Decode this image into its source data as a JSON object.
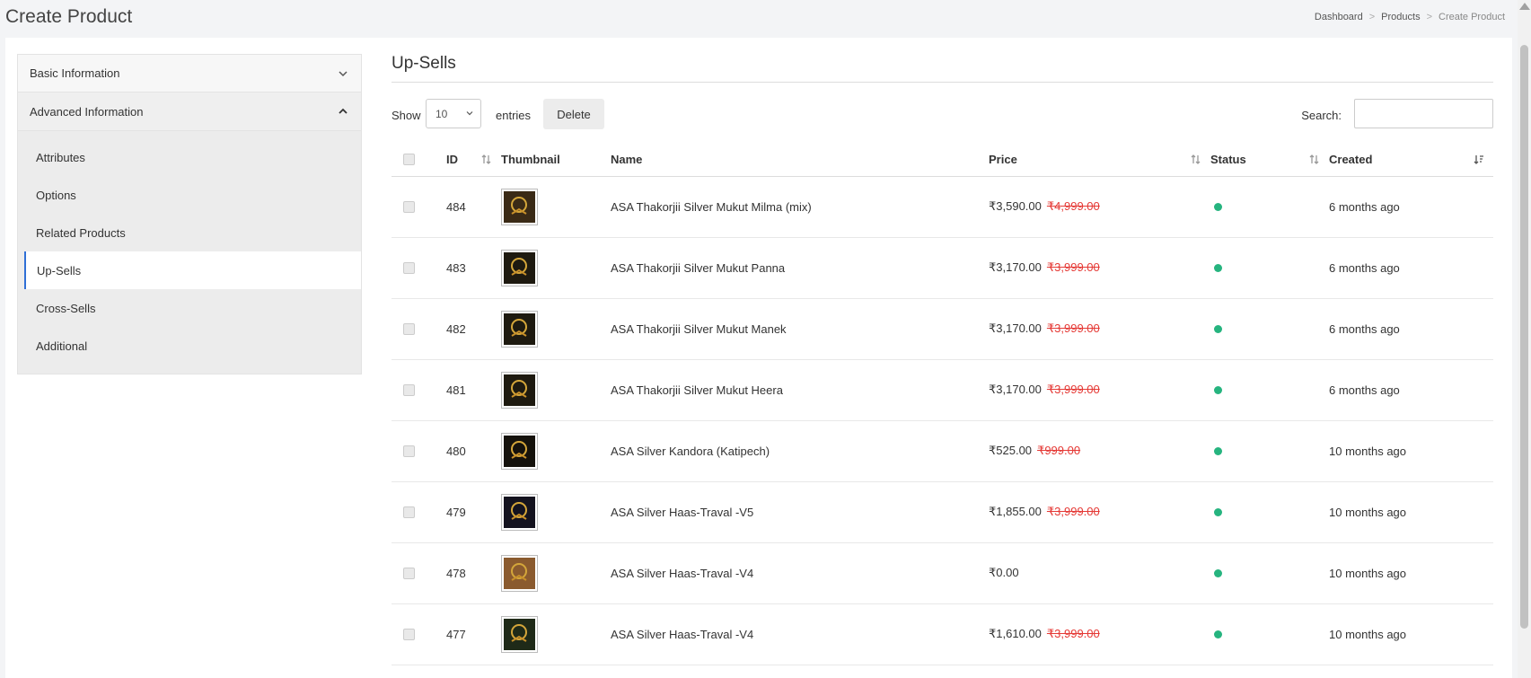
{
  "header": {
    "title": "Create Product",
    "breadcrumb": [
      "Dashboard",
      "Products",
      "Create Product"
    ],
    "separator": ">"
  },
  "sidebar": {
    "sections": [
      {
        "label": "Basic Information",
        "expanded": false
      },
      {
        "label": "Advanced Information",
        "expanded": true
      }
    ],
    "items": [
      {
        "label": "Attributes",
        "active": false
      },
      {
        "label": "Options",
        "active": false
      },
      {
        "label": "Related Products",
        "active": false
      },
      {
        "label": "Up-Sells",
        "active": true
      },
      {
        "label": "Cross-Sells",
        "active": false
      },
      {
        "label": "Additional",
        "active": false
      }
    ]
  },
  "main": {
    "title": "Up-Sells",
    "show_label": "Show",
    "entries_value": "10",
    "entries_label": "entries",
    "delete_label": "Delete",
    "search_label": "Search:",
    "search_value": "",
    "columns": [
      "ID",
      "Thumbnail",
      "Name",
      "Price",
      "Status",
      "Created"
    ],
    "rows": [
      {
        "id": "484",
        "name": "ASA Thakorjii Silver Mukut Milma (mix)",
        "price": "₹3,590.00",
        "old_price": "₹4,999.00",
        "created": "6 months ago",
        "thumb_color": "#3a2a16"
      },
      {
        "id": "483",
        "name": "ASA Thakorjii Silver Mukut Panna",
        "price": "₹3,170.00",
        "old_price": "₹3,999.00",
        "created": "6 months ago",
        "thumb_color": "#1e1a10"
      },
      {
        "id": "482",
        "name": "ASA Thakorjii Silver Mukut Manek",
        "price": "₹3,170.00",
        "old_price": "₹3,999.00",
        "created": "6 months ago",
        "thumb_color": "#1e1a10"
      },
      {
        "id": "481",
        "name": "ASA Thakorjii Silver Mukut Heera",
        "price": "₹3,170.00",
        "old_price": "₹3,999.00",
        "created": "6 months ago",
        "thumb_color": "#1e1a10"
      },
      {
        "id": "480",
        "name": "ASA Silver Kandora (Katipech)",
        "price": "₹525.00",
        "old_price": "₹999.00",
        "created": "10 months ago",
        "thumb_color": "#15120c"
      },
      {
        "id": "479",
        "name": "ASA Silver Haas-Traval -V5",
        "price": "₹1,855.00",
        "old_price": "₹3,999.00",
        "created": "10 months ago",
        "thumb_color": "#14131f"
      },
      {
        "id": "478",
        "name": "ASA Silver Haas-Traval -V4",
        "price": "₹0.00",
        "old_price": "",
        "created": "10 months ago",
        "thumb_color": "#8a5a2e"
      },
      {
        "id": "477",
        "name": "ASA Silver Haas-Traval -V4",
        "price": "₹1,610.00",
        "old_price": "₹3,999.00",
        "created": "10 months ago",
        "thumb_color": "#1f2a18"
      }
    ]
  },
  "colors": {
    "accent": "#2f6fd6",
    "status_active": "#26b47f",
    "old_price": "#e53935"
  }
}
